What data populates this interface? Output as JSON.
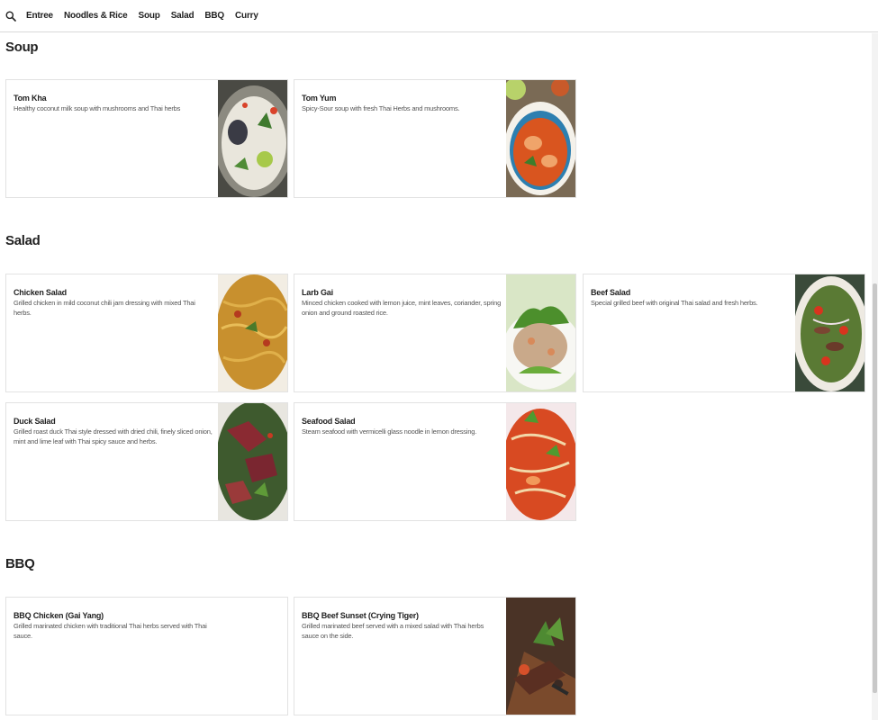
{
  "nav": {
    "search_icon": "search-icon",
    "links": [
      "Entree",
      "Noodles & Rice",
      "Soup",
      "Salad",
      "BBQ",
      "Curry"
    ]
  },
  "sections": {
    "soup": {
      "title": "Soup",
      "items": [
        {
          "name": "Tom Kha",
          "desc": "Healthy coconut milk soup with mushrooms and Thai herbs"
        },
        {
          "name": "Tom Yum",
          "desc": "Spicy-Sour soup with fresh Thai Herbs and mushrooms."
        }
      ]
    },
    "salad": {
      "title": "Salad",
      "items": [
        {
          "name": "Chicken Salad",
          "desc": "Grilled chicken in mild coconut chili jam dressing with mixed Thai herbs."
        },
        {
          "name": "Larb Gai",
          "desc": "Minced chicken cooked with lemon juice, mint leaves, coriander, spring onion and ground roasted rice."
        },
        {
          "name": "Beef Salad",
          "desc": "Special grilled beef with original Thai salad and fresh herbs."
        },
        {
          "name": "Duck Salad",
          "desc": "Grilled roast duck Thai style dressed with dried chili, finely sliced onion, mint and lime leaf with Thai spicy sauce and herbs."
        },
        {
          "name": "Seafood Salad",
          "desc": "Steam seafood with vermicelli glass noodle in lemon dressing."
        }
      ]
    },
    "bbq": {
      "title": "BBQ",
      "items": [
        {
          "name": "BBQ Chicken (Gai Yang)",
          "desc": "Grilled marinated chicken with traditional Thai herbs served with Thai sauce."
        },
        {
          "name": "BBQ Beef Sunset (Crying Tiger)",
          "desc": "Grilled marinated beef served with a mixed salad with Thai herbs sauce on the side."
        }
      ]
    }
  },
  "colors": {
    "text": "#222222",
    "muted": "#555555",
    "border": "#e2e2e2",
    "divider": "#d9d9d9"
  }
}
